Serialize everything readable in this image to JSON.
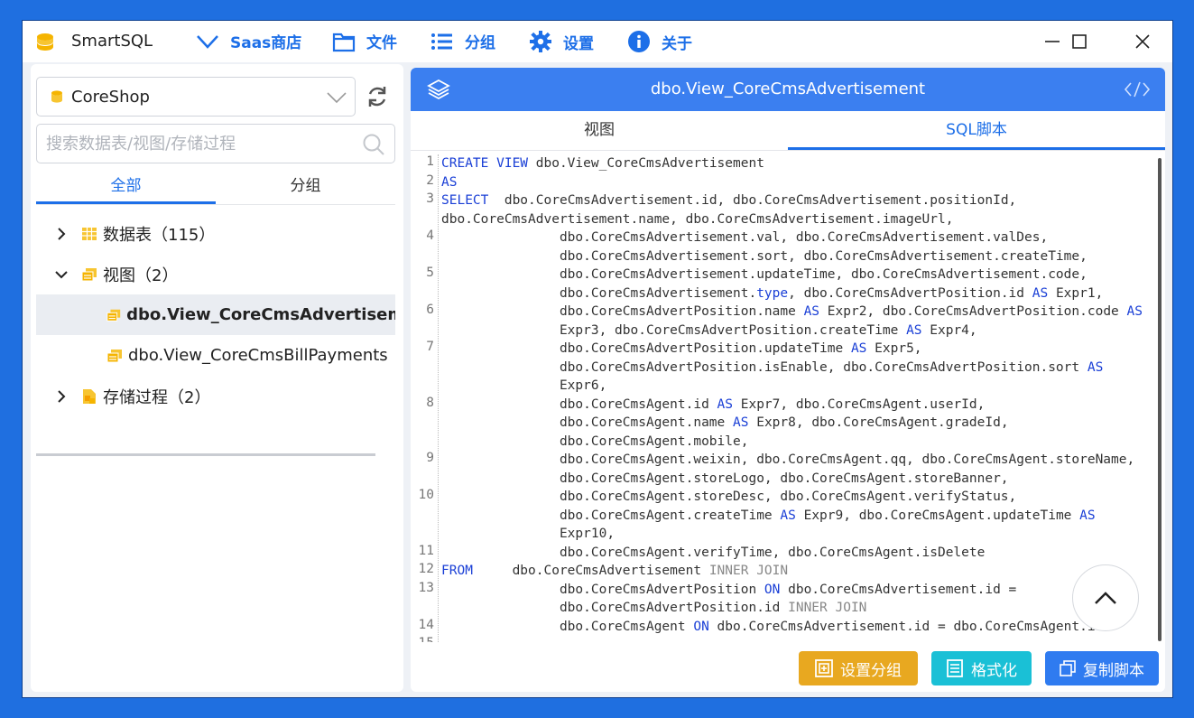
{
  "titlebar": {
    "app_name": "SmartSQL",
    "menu": [
      {
        "label": "Saas商店",
        "icon": "chevron-down-icon"
      },
      {
        "label": "文件",
        "icon": "folder-icon"
      },
      {
        "label": "分组",
        "icon": "list-icon"
      },
      {
        "label": "设置",
        "icon": "gear-icon"
      },
      {
        "label": "关于",
        "icon": "info-icon"
      }
    ]
  },
  "sidebar": {
    "database": "CoreShop",
    "search_placeholder": "搜索数据表/视图/存储过程",
    "tabs": [
      "全部",
      "分组"
    ],
    "tree": {
      "tables": "数据表（115）",
      "views": "视图（2）",
      "view_items": [
        "dbo.View_CoreCmsAdvertisemen",
        "dbo.View_CoreCmsBillPayments"
      ],
      "procedures": "存储过程（2）"
    }
  },
  "main": {
    "title": "dbo.View_CoreCmsAdvertisement",
    "tabs": [
      "视图",
      "SQL脚本"
    ],
    "buttons": {
      "set_group": "设置分组",
      "format": "格式化",
      "copy_script": "复制脚本"
    },
    "colors": {
      "accent": "#1d6fe8",
      "set_group": "#e8a820",
      "format": "#1ac0d6",
      "copy_script": "#2f7bf0"
    }
  }
}
